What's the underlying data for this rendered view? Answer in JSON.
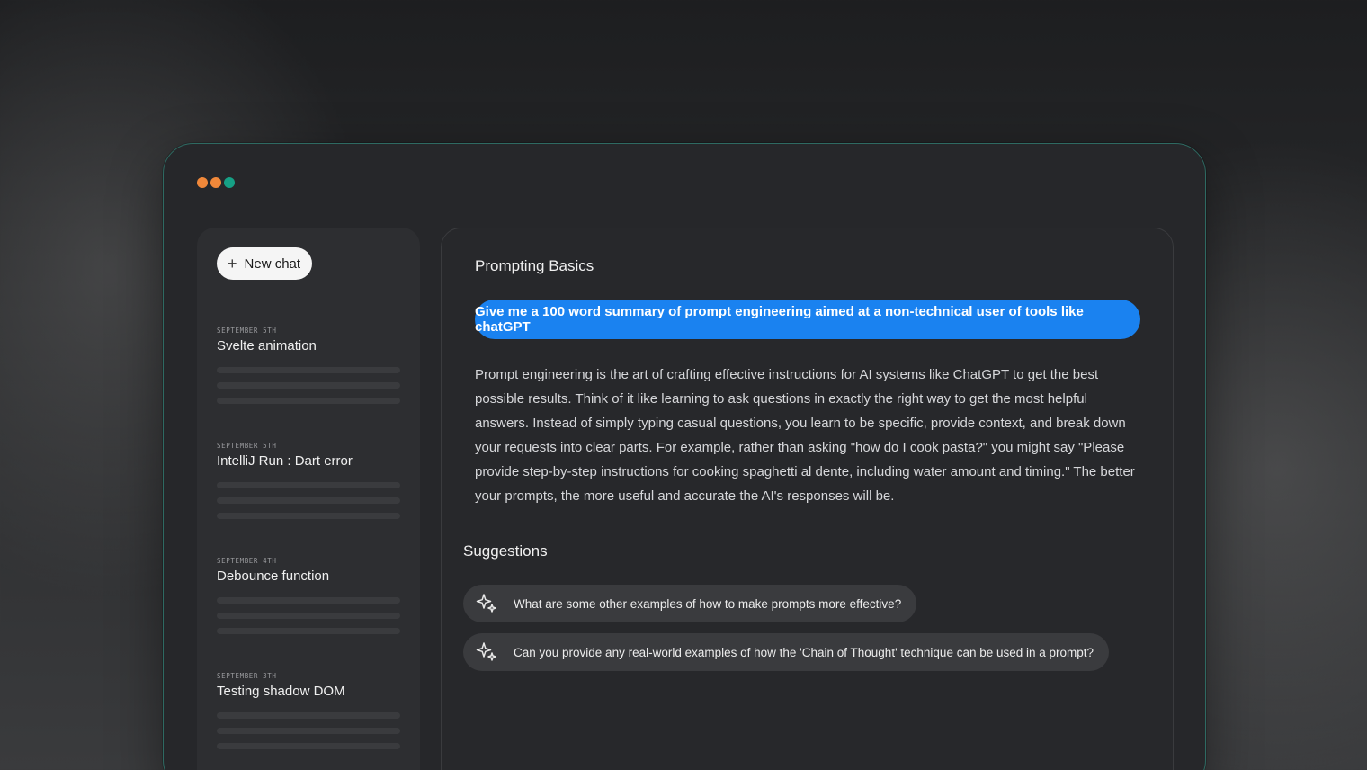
{
  "window": {
    "controls": [
      {
        "name": "close",
        "color": "#f0883a"
      },
      {
        "name": "minimize",
        "color": "#f0883a"
      },
      {
        "name": "maximize",
        "color": "#16a085"
      }
    ]
  },
  "sidebar": {
    "new_chat_label": "New chat",
    "new_chat_icon": "plus-icon",
    "history": [
      {
        "date": "September 5th",
        "title": "Svelte animation"
      },
      {
        "date": "September 5th",
        "title": "IntelliJ Run : Dart error"
      },
      {
        "date": "September 4th",
        "title": "Debounce function"
      },
      {
        "date": "September 3th",
        "title": "Testing shadow DOM"
      }
    ]
  },
  "main": {
    "title": "Prompting Basics",
    "user_message": "Give me a 100 word summary of prompt engineering aimed at a non-technical user of tools like chatGPT",
    "assistant_message": "Prompt engineering is the art of crafting effective instructions for AI systems like ChatGPT to get the best possible results. Think of it like learning to ask questions in exactly the right way to get the most helpful answers. Instead of simply typing casual questions, you learn to be specific, provide context, and break down your requests into clear parts. For example, rather than asking \"how do I cook pasta?\" you might say \"Please provide step-by-step instructions for cooking spaghetti al dente, including water amount and timing.\" The better your prompts, the more useful and accurate the AI's responses will be.",
    "suggestions_heading": "Suggestions",
    "suggestion_icon": "sparkle-icon",
    "suggestions": [
      "What are some other examples of how to make prompts more effective?",
      "Can you provide any real-world examples of how the 'Chain of Thought' technique can be used in a prompt?"
    ]
  },
  "colors": {
    "accent_blue": "#1a82f0",
    "window_border": "#2e6a62"
  }
}
